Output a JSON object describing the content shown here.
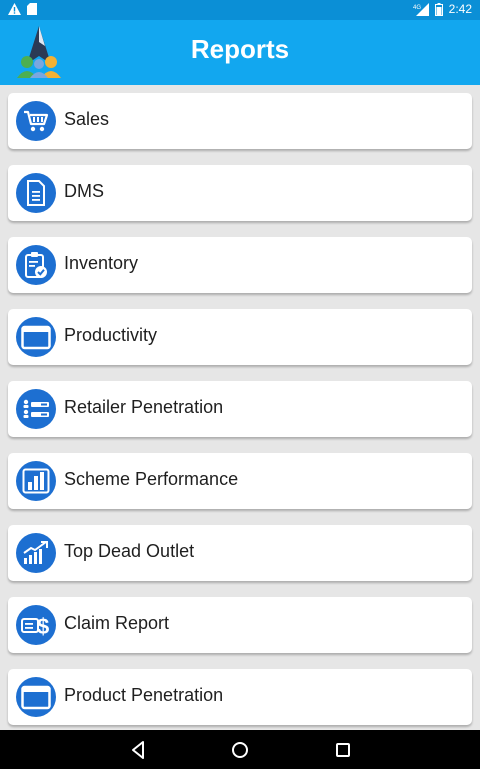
{
  "status_bar": {
    "time": "2:42",
    "left_icons": [
      "warning-icon",
      "sd-card-icon"
    ],
    "right_icons": [
      "signal-4g-icon",
      "battery-icon"
    ]
  },
  "app_bar": {
    "title": "Reports",
    "logo": "app-logo"
  },
  "reports": [
    {
      "label": "Sales",
      "icon": "cart-icon"
    },
    {
      "label": "DMS",
      "icon": "document-icon"
    },
    {
      "label": "Inventory",
      "icon": "clipboard-check-icon"
    },
    {
      "label": "Productivity",
      "icon": "window-icon"
    },
    {
      "label": "Retailer Penetration",
      "icon": "users-list-icon"
    },
    {
      "label": "Scheme Performance",
      "icon": "bar-chart-icon"
    },
    {
      "label": "Top Dead Outlet",
      "icon": "trend-chart-icon"
    },
    {
      "label": "Claim Report",
      "icon": "money-icon"
    },
    {
      "label": "Product Penetration",
      "icon": "window-icon"
    }
  ],
  "nav_bar": {
    "buttons": [
      "back-icon",
      "home-icon",
      "recents-icon"
    ]
  },
  "colors": {
    "status_bar": "#0b8fd6",
    "app_bar": "#12a7ef",
    "icon_circle": "#1d6fd1",
    "background": "#e6e6e6"
  }
}
